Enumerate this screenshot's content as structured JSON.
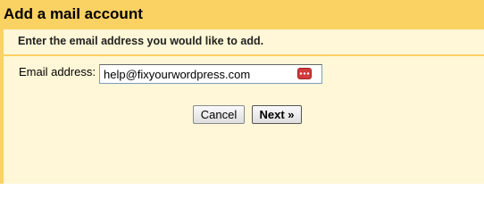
{
  "dialog": {
    "title": "Add a mail account",
    "instruction": "Enter the email address you would like to add.",
    "email_label": "Email address:",
    "email_value": "help@fixyourwordpress.com",
    "email_placeholder": "",
    "password_manager_icon": "password-manager-icon",
    "cancel_label": "Cancel",
    "next_label": "Next »"
  },
  "colors": {
    "header_bg": "#fad163",
    "body_bg": "#fff7d7",
    "icon_red": "#d13b3b"
  }
}
